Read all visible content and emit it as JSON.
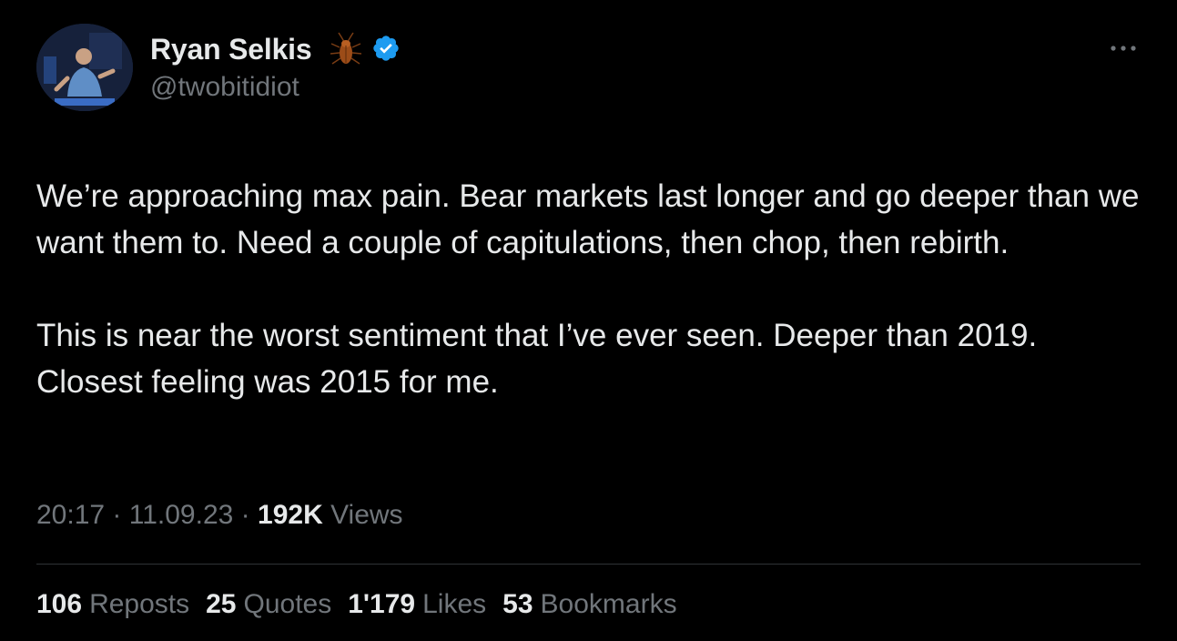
{
  "author": {
    "display_name": "Ryan Selkis",
    "handle": "@twobitidiot",
    "emoji_icon": "cockroach-icon",
    "verified_icon": "verified-badge-icon",
    "verified_color": "#1d9bf0"
  },
  "header": {
    "more_icon": "more-options-icon"
  },
  "tweet": {
    "paragraphs": [
      "We’re approaching max pain. Bear markets last longer and go deeper than we want them to. Need a couple of capitulations, then chop, then rebirth.",
      "This is near the worst sentiment that I’ve ever seen. Deeper than 2019. Closest feeling was 2015 for me."
    ]
  },
  "meta": {
    "time": "20:17",
    "separator": "·",
    "date": "11.09.23",
    "views_count": "192K",
    "views_label": "Views"
  },
  "stats": {
    "reposts": {
      "count": "106",
      "label": "Reposts"
    },
    "quotes": {
      "count": "25",
      "label": "Quotes"
    },
    "likes": {
      "count": "1'179",
      "label": "Likes"
    },
    "bookmarks": {
      "count": "53",
      "label": "Bookmarks"
    }
  },
  "colors": {
    "background": "#000000",
    "primary_text": "#e7e9ea",
    "secondary_text": "#71767b",
    "divider": "#2f3336"
  }
}
